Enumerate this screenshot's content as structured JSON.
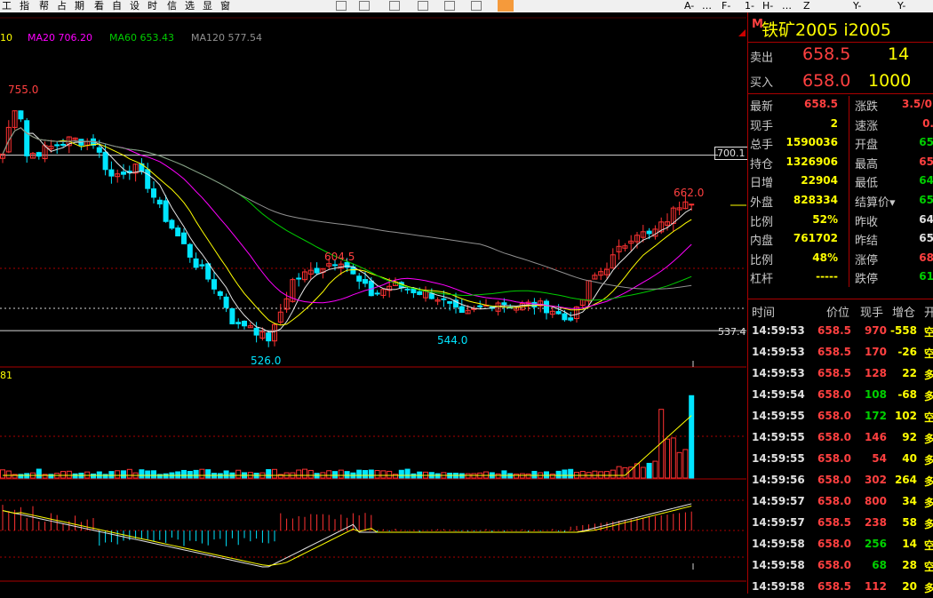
{
  "menubar": {
    "items": [
      "工",
      "指",
      "帮",
      "占",
      "期",
      "看",
      "自",
      "设",
      "时",
      "信",
      "选",
      "显",
      "窗"
    ],
    "right_items": [
      "A-",
      "…",
      "F-",
      "1-",
      "H-",
      "…",
      "Z",
      "Y-",
      "Y-"
    ]
  },
  "indicators": {
    "prefix": "10",
    "ma20": "MA20 706.20",
    "ma60": "MA60 653.43",
    "ma120": "MA120 577.54"
  },
  "price_labels": {
    "high_755": "755.0",
    "high_604": "604.5",
    "low_526": "526.0",
    "low_544": "544.0",
    "high_662": "662.0",
    "level_700": "700.1",
    "level_537": "537.4"
  },
  "volume_label": "81",
  "colors": {
    "up": "#ff3232",
    "down": "#00e5ff",
    "ma5": "#e6e6e6",
    "ma10": "#ffff00",
    "ma20": "#ff00ff",
    "ma60": "#00cc00",
    "ma120": "#909090",
    "frame": "#aa0000"
  },
  "chart_data": {
    "type": "candlestick",
    "title": "铁矿2005 i2005",
    "y_range": [
      526.0,
      755.0
    ],
    "annotations": [
      {
        "label": "755.0",
        "value": 755.0
      },
      {
        "label": "604.5",
        "value": 604.5
      },
      {
        "label": "526.0",
        "value": 526.0
      },
      {
        "label": "544.0",
        "value": 544.0
      },
      {
        "label": "662.0",
        "value": 662.0
      }
    ],
    "reference_levels": [
      700.1,
      537.4
    ],
    "last_close": 658.0,
    "moving_averages": {
      "MA20": 706.2,
      "MA60": 653.43,
      "MA120": 577.54
    }
  },
  "panel": {
    "badge": "M",
    "title": "铁矿2005  i2005",
    "sell_label": "卖出",
    "sell_price": "658.5",
    "sell_qty": "14",
    "buy_label": "买入",
    "buy_price": "658.0",
    "buy_qty": "1000",
    "stats": [
      {
        "l1": "最新",
        "v1": "658.5",
        "c1": "red",
        "l2": "涨跌",
        "v2": "3.5/0.",
        "c2": "red"
      },
      {
        "l1": "现手",
        "v1": "2",
        "c1": "yel",
        "l2": "速涨",
        "v2": "0.",
        "c2": "red"
      },
      {
        "l1": "总手",
        "v1": "1590036",
        "c1": "yel",
        "l2": "开盘",
        "v2": "65",
        "c2": "grn"
      },
      {
        "l1": "持仓",
        "v1": "1326906",
        "c1": "yel",
        "l2": "最高",
        "v2": "65",
        "c2": "red"
      },
      {
        "l1": "日增",
        "v1": "22904",
        "c1": "yel",
        "l2": "最低",
        "v2": "64",
        "c2": "grn"
      },
      {
        "l1": "外盘",
        "v1": "828334",
        "c1": "yel",
        "l2": "结算价▾",
        "v2": "65",
        "c2": "grn"
      },
      {
        "l1": "比例",
        "v1": "52%",
        "c1": "yel",
        "l2": "昨收",
        "v2": "64",
        "c2": "wh"
      },
      {
        "l1": "内盘",
        "v1": "761702",
        "c1": "yel",
        "l2": "昨结",
        "v2": "65",
        "c2": "wh"
      },
      {
        "l1": "比例",
        "v1": "48%",
        "c1": "yel",
        "l2": "涨停",
        "v2": "68",
        "c2": "red"
      },
      {
        "l1": "杠杆",
        "v1": "-----",
        "c1": "yel",
        "l2": "跌停",
        "v2": "61",
        "c2": "grn"
      }
    ],
    "trade_headers": [
      "时间",
      "价位",
      "现手",
      "增仓",
      "开"
    ],
    "trades": [
      {
        "time": "14:59:53",
        "price": "658.5",
        "qty": "970",
        "inc": "-558",
        "dir": "空",
        "pc": "red",
        "qc": "red",
        "ic": "yel"
      },
      {
        "time": "14:59:53",
        "price": "658.5",
        "qty": "170",
        "inc": "-26",
        "dir": "空",
        "pc": "red",
        "qc": "red",
        "ic": "yel"
      },
      {
        "time": "14:59:53",
        "price": "658.5",
        "qty": "128",
        "inc": "22",
        "dir": "多",
        "pc": "red",
        "qc": "red",
        "ic": "yel"
      },
      {
        "time": "14:59:54",
        "price": "658.0",
        "qty": "108",
        "inc": "-68",
        "dir": "多",
        "pc": "red",
        "qc": "grn",
        "ic": "yel"
      },
      {
        "time": "14:59:55",
        "price": "658.0",
        "qty": "172",
        "inc": "102",
        "dir": "空",
        "pc": "red",
        "qc": "grn",
        "ic": "yel"
      },
      {
        "time": "14:59:55",
        "price": "658.0",
        "qty": "146",
        "inc": "92",
        "dir": "多",
        "pc": "red",
        "qc": "red",
        "ic": "yel"
      },
      {
        "time": "14:59:55",
        "price": "658.0",
        "qty": "54",
        "inc": "40",
        "dir": "多",
        "pc": "red",
        "qc": "red",
        "ic": "yel"
      },
      {
        "time": "14:59:56",
        "price": "658.0",
        "qty": "302",
        "inc": "264",
        "dir": "多",
        "pc": "red",
        "qc": "red",
        "ic": "yel"
      },
      {
        "time": "14:59:57",
        "price": "658.0",
        "qty": "800",
        "inc": "34",
        "dir": "多",
        "pc": "red",
        "qc": "red",
        "ic": "yel"
      },
      {
        "time": "14:59:57",
        "price": "658.5",
        "qty": "238",
        "inc": "58",
        "dir": "多",
        "pc": "red",
        "qc": "red",
        "ic": "yel"
      },
      {
        "time": "14:59:58",
        "price": "658.0",
        "qty": "256",
        "inc": "14",
        "dir": "空",
        "pc": "red",
        "qc": "grn",
        "ic": "yel"
      },
      {
        "time": "14:59:58",
        "price": "658.0",
        "qty": "68",
        "inc": "28",
        "dir": "空",
        "pc": "red",
        "qc": "grn",
        "ic": "yel"
      },
      {
        "time": "14:59:58",
        "price": "658.5",
        "qty": "112",
        "inc": "20",
        "dir": "多",
        "pc": "red",
        "qc": "red",
        "ic": "yel"
      }
    ]
  }
}
